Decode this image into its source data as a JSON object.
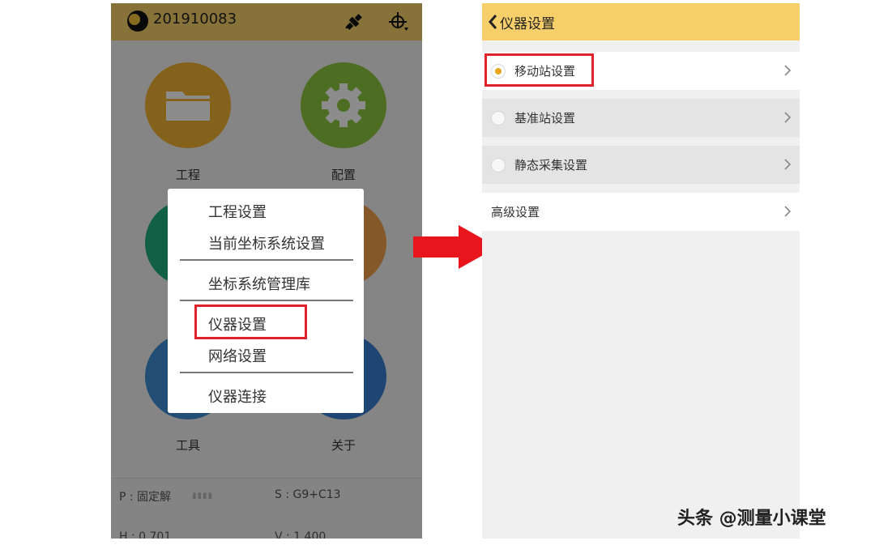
{
  "left_screen": {
    "header": {
      "device_id": "201910083",
      "satellite_icon": "satellite-icon",
      "gps_icon": "gps-crosshair-icon"
    },
    "tiles": [
      {
        "label": "工程",
        "icon": "folder-icon",
        "color": "#f2b233"
      },
      {
        "label": "配置",
        "icon": "gear-icon",
        "color": "#8cc63f"
      },
      {
        "label": "",
        "icon": "measure-icon",
        "color": "#1fae7c"
      },
      {
        "label": "",
        "icon": "stake-icon",
        "color": "#f0a14c"
      },
      {
        "label": "工具",
        "icon": "tools-icon",
        "color": "#3e8fd6"
      },
      {
        "label": "关于",
        "icon": "info-icon",
        "color": "#3a7fd0"
      }
    ],
    "status": {
      "p": "P : 固定解",
      "s": "S : G9+C13",
      "h": "H : 0.701",
      "v": "V : 1.400"
    },
    "popup_menu": {
      "items": [
        "工程设置",
        "当前坐标系统设置",
        "坐标系统管理库",
        "仪器设置",
        "网络设置",
        "仪器连接"
      ],
      "highlighted": "仪器设置"
    }
  },
  "arrow": {
    "icon": "right-arrow-icon",
    "color": "#e8161c"
  },
  "right_screen": {
    "header": {
      "back_icon": "chevron-left-icon",
      "title": "仪器设置"
    },
    "rows": [
      {
        "label": "移动站设置",
        "selected": true,
        "has_radio": true,
        "chevron": "chevron-right-icon"
      },
      {
        "label": "基准站设置",
        "selected": false,
        "has_radio": true,
        "chevron": "chevron-right-icon"
      },
      {
        "label": "静态采集设置",
        "selected": false,
        "has_radio": true,
        "chevron": "chevron-right-icon"
      },
      {
        "label": "高级设置",
        "selected": false,
        "has_radio": false,
        "chevron": "chevron-right-icon"
      }
    ],
    "highlighted": "移动站设置"
  },
  "watermark": "头条 @测量小课堂",
  "colors": {
    "header": "#f6cf6a",
    "highlight": "#e0232b",
    "radio_on": "#e6a51c"
  }
}
